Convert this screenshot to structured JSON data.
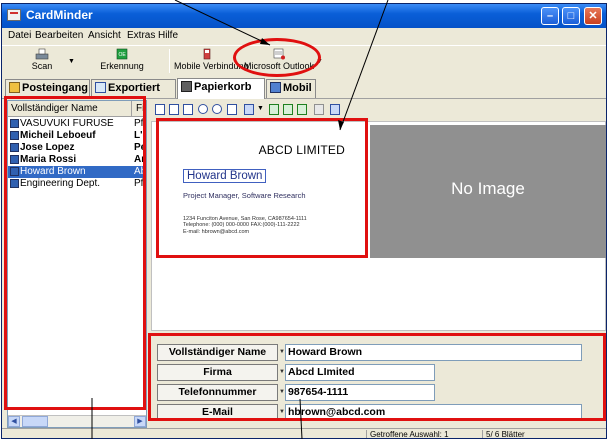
{
  "window": {
    "title": "CardMinder"
  },
  "menu": [
    "Datei",
    "Bearbeiten",
    "Ansicht",
    "Extras",
    "Hilfe"
  ],
  "toolbar": {
    "scan_label": "Scan",
    "erkennung_label": "Erkennung",
    "mobile_label": "Mobile Verbindung",
    "outlook_label": "Microsoft Outlook"
  },
  "tabs": [
    {
      "label": "Posteingang"
    },
    {
      "label": "Exportiert"
    },
    {
      "label": "Papierkorb"
    },
    {
      "label": "Mobil"
    }
  ],
  "list": {
    "col_name": "Vollständiger Name",
    "col_second": "Fir",
    "rows": [
      {
        "name": "VASUVUKI FURUSE",
        "second": "Pfu"
      },
      {
        "name": "Micheil Leboeuf",
        "second": "L'h"
      },
      {
        "name": "Jose Lopez",
        "second": "Pe"
      },
      {
        "name": "Maria Rossi",
        "second": "An"
      },
      {
        "name": "Howard Brown",
        "second": "Ab"
      },
      {
        "name": "Engineering Dept.",
        "second": "Pfu"
      }
    ]
  },
  "card": {
    "company": "ABCD LIMITED",
    "name": "Howard Brown",
    "title": "Project Manager, Software Research",
    "address": "1234 Funciton Avenue, San Rose, CA987654-1111",
    "telephone": "Telephone: (000) 000-0000  FAX:(000)-111-2222",
    "email": "E-mail: hbrown@abcd.com"
  },
  "no_image": "No Image",
  "fields": {
    "name_label": "Vollständiger Name",
    "name_value": "Howard Brown",
    "firma_label": "Firma",
    "firma_value": "Abcd LImited",
    "phone_label": "Telefonnummer",
    "phone_value": "987654-1111",
    "email_label": "E-Mail",
    "email_value": "hbrown@abcd.com"
  },
  "status": {
    "selection": "Getroffene Auswahl:  1",
    "pages": "5/   6 Blätter"
  },
  "colors": {
    "highlight": "#e01010",
    "titlebar": "#0552c8",
    "selection": "#316ac5"
  }
}
